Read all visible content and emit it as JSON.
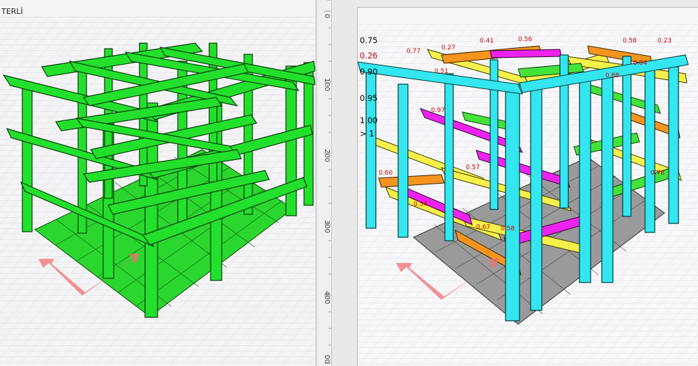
{
  "left_view": {
    "title_fragment": "TERLİ",
    "frame_color": "#22e02c"
  },
  "ruler": {
    "ticks": [
      "0",
      "100",
      "200",
      "300",
      "400",
      "00"
    ]
  },
  "right_view": {
    "ratio_legend": [
      {
        "label": "0.75",
        "color": "#111111"
      },
      {
        "label": "0.26",
        "color": "#cc0000"
      },
      {
        "label": "0.90",
        "color": "#111111"
      },
      {
        "label": "0.95",
        "color": "#111111"
      },
      {
        "label": "1.00",
        "color": "#111111"
      },
      {
        "label": "> 1",
        "color": "#111111"
      }
    ],
    "member_colors": {
      "columns": "#33e6f0",
      "beam_yellow": "#f6f04a",
      "beam_orange": "#f5941e",
      "beam_magenta": "#ee22ee",
      "beam_green": "#44e33a"
    },
    "ratio_values": [
      "0.27",
      "0.41",
      "0.56",
      "0.58",
      "0.23",
      "0.77",
      "0.51",
      "0.84",
      "0.97",
      "0.60",
      "0.67",
      "0.54",
      "0.58",
      "0.57",
      "0.88",
      "0.78"
    ]
  }
}
